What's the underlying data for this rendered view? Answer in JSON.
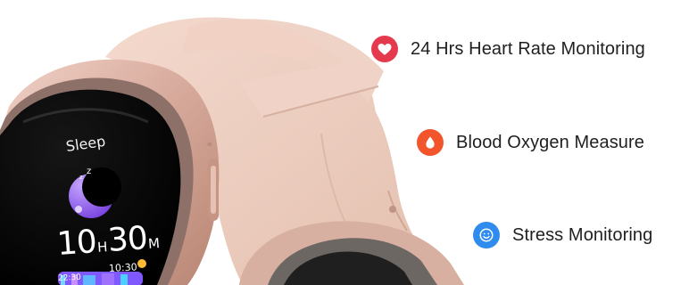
{
  "features": [
    {
      "label": "24 Hrs Heart Rate Monitoring",
      "icon": "heart-icon",
      "color": "#e53a4e"
    },
    {
      "label": "Blood Oxygen Measure",
      "icon": "blood-drop-icon",
      "color": "#f2552c"
    },
    {
      "label": "Stress Monitoring",
      "icon": "smile-face-icon",
      "color": "#2f8bee"
    }
  ],
  "watch_screen": {
    "title": "Sleep",
    "hours": "10",
    "hours_unit": "H",
    "minutes": "30",
    "minutes_unit": "M",
    "range_end": "10:30",
    "range_start": "22:30"
  },
  "colors": {
    "strap": "#e8c6b6",
    "case": "#d3a898",
    "screen": "#050505",
    "sleep_icon": "#8d56e8"
  }
}
